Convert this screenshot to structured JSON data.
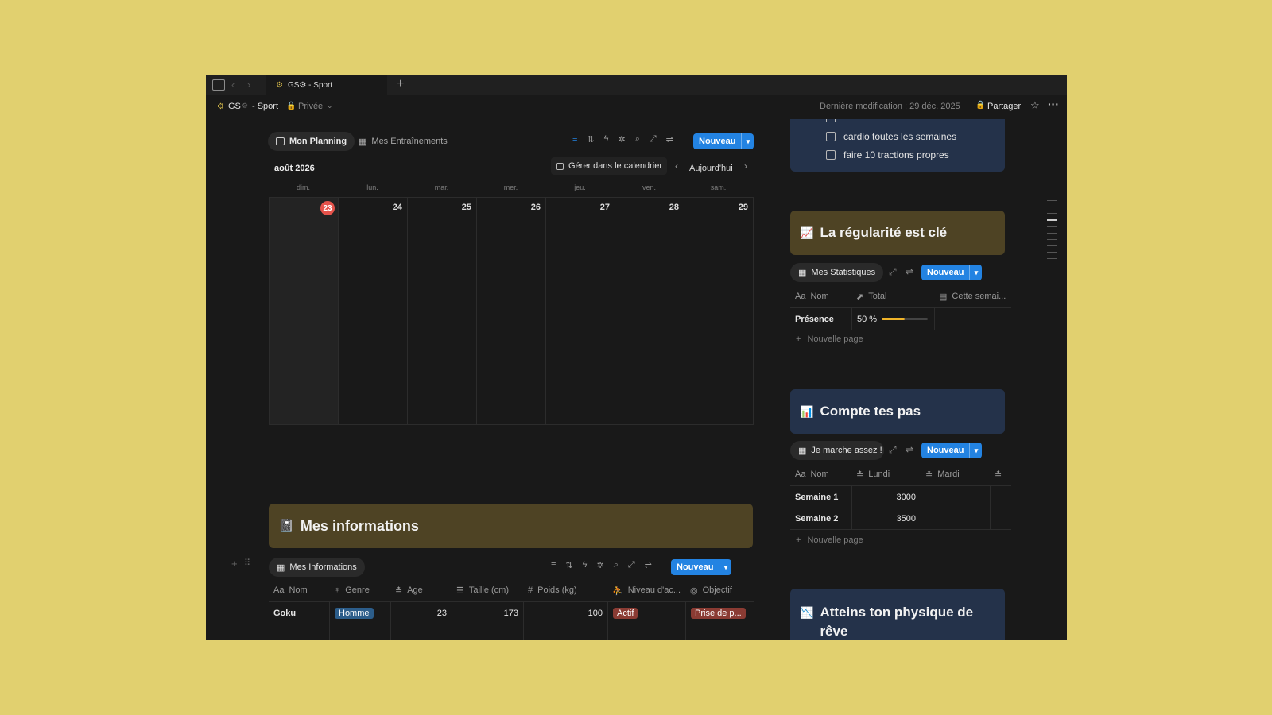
{
  "tabbar": {
    "tab_title": "GS⚙ - Sport",
    "new_tab_icon": "plus-icon"
  },
  "topbar": {
    "breadcrumb_page": "GS",
    "breadcrumb_suffix": "- Sport",
    "privacy": "Privée",
    "last_modified": "Dernière modification : 29 déc. 2025",
    "share": "Partager"
  },
  "planning": {
    "tab_active": "Mon Planning",
    "tab_other": "Mes Entraînements",
    "new_button": "Nouveau",
    "month": "août 2026",
    "manage_calendar": "Gérer dans le calendrier",
    "today": "Aujourd'hui",
    "weekdays": [
      "dim.",
      "lun.",
      "mar.",
      "mer.",
      "jeu.",
      "ven.",
      "sam."
    ],
    "days": [
      "23",
      "24",
      "25",
      "26",
      "27",
      "28",
      "29"
    ],
    "today_day": "23"
  },
  "infos_callout": {
    "emoji": "📓",
    "title": "Mes informations"
  },
  "infos_table": {
    "view_tab": "Mes Informations",
    "new_button": "Nouveau",
    "columns": [
      "Nom",
      "Genre",
      "Age",
      "Taille (cm)",
      "Poids (kg)",
      "Niveau d'ac...",
      "Objectif"
    ],
    "row": {
      "nom": "Goku",
      "genre": "Homme",
      "age": "23",
      "taille": "173",
      "poids": "100",
      "niveau": "Actif",
      "objectif": "Prise de p..."
    }
  },
  "goals": {
    "items": [
      {
        "label": "cardio toutes les semaines",
        "checked": false
      },
      {
        "label": "faire 10 tractions propres",
        "checked": false
      }
    ]
  },
  "regularite": {
    "emoji": "📈",
    "title": "La régularité est clé",
    "view_tab": "Mes Statistiques",
    "new_button": "Nouveau",
    "columns": [
      "Nom",
      "Total",
      "Cette semai..."
    ],
    "row_name": "Présence",
    "row_total": "50 %",
    "progress": 0.5,
    "new_page": "Nouvelle page"
  },
  "pas": {
    "emoji": "📊",
    "title": "Compte tes pas",
    "view_tab": "Je marche assez !",
    "new_button": "Nouveau",
    "columns": [
      "Nom",
      "Lundi",
      "Mardi"
    ],
    "rows": [
      {
        "nom": "Semaine 1",
        "lundi": "3000"
      },
      {
        "nom": "Semaine 2",
        "lundi": "3500"
      }
    ],
    "new_page": "Nouvelle page"
  },
  "physique": {
    "emoji": "📉",
    "title": "Atteins ton physique de rêve"
  },
  "colors": {
    "accent": "#2383e2",
    "brown_callout": "#4e4324",
    "navy_callout": "#24324a",
    "today": "#e5534b",
    "progress": "#f0b429"
  }
}
